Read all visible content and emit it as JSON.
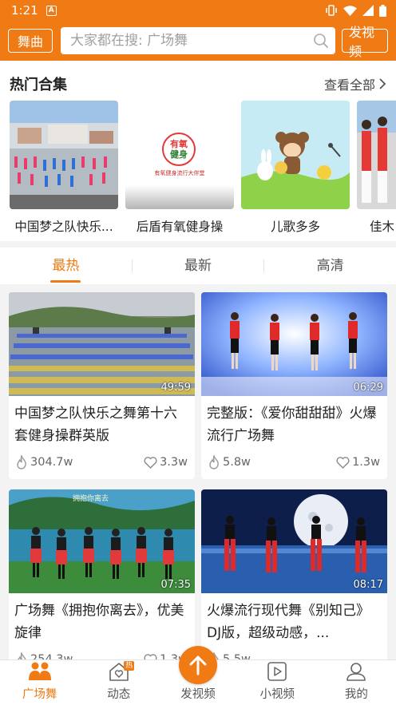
{
  "status": {
    "time": "1:21",
    "notif": "A"
  },
  "header": {
    "left_button": "舞曲",
    "search_placeholder": "大家都在搜: 广场舞",
    "right_button": "发视频"
  },
  "hot": {
    "title": "热门合集",
    "see_all": "查看全部",
    "items": [
      {
        "label": "中国梦之队快乐..."
      },
      {
        "label": "后盾有氧健身操",
        "logo_top": "有氧",
        "logo_bottom": "健身",
        "logo_caption": "有氧健身流行大伴堂"
      },
      {
        "label": "儿歌多多"
      },
      {
        "label": "佳木"
      }
    ]
  },
  "tabs": [
    "最热",
    "最新",
    "高清"
  ],
  "videos": [
    {
      "title": "中国梦之队快乐之舞第十六套健身操群英版",
      "duration": "49:59",
      "plays": "304.7w",
      "likes": "3.3w"
    },
    {
      "title": "完整版：《爱你甜甜甜》火爆流行广场舞",
      "duration": "06:29",
      "plays": "5.8w",
      "likes": "1.3w"
    },
    {
      "title": "广场舞《拥抱你离去》，优美旋律",
      "duration": "07:35",
      "plays": "254.3w",
      "likes": "1.3w",
      "overlay_text": "拥抱你离去"
    },
    {
      "title": "火爆流行现代舞《别知己》DJ版，超级动感，...",
      "duration": "08:17",
      "plays": "5.5w",
      "likes": ""
    }
  ],
  "nav": [
    {
      "label": "广场舞",
      "icon": "dancers-icon"
    },
    {
      "label": "动态",
      "icon": "heart-icon",
      "badge": "热"
    },
    {
      "label": "发视频",
      "icon": "upload-icon"
    },
    {
      "label": "小视频",
      "icon": "play-icon"
    },
    {
      "label": "我的",
      "icon": "user-icon"
    }
  ],
  "colors": {
    "accent": "#f07a13"
  }
}
